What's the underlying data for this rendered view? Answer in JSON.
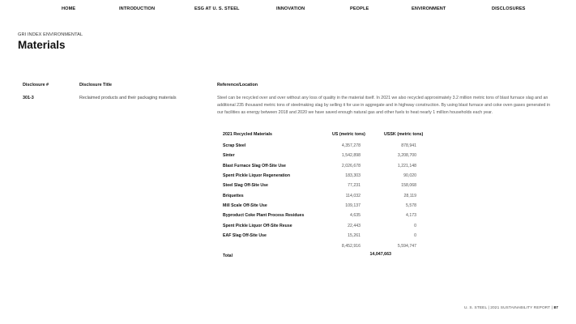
{
  "nav": {
    "items": [
      "HOME",
      "INTRODUCTION",
      "ESG AT U. S. STEEL",
      "INNOVATION",
      "PEOPLE",
      "ENVIRONMENT",
      "DISCLOSURES"
    ]
  },
  "header": {
    "section_label": "GRI INDEX ENVIRONMENTAL",
    "title": "Materials"
  },
  "disclosure_table": {
    "columns": [
      "Disclosure #",
      "Disclosure Title",
      "Reference/Location"
    ],
    "row": {
      "code": "301-3",
      "title": "Reclaimed products and their packaging materials",
      "reference": "Steel can be recycled over and over without any loss of quality in the material itself. In 2021 we also recycled approximately 3.2 million metric tons of blast furnace slag and an additional 235 thousand metric tons of steelmaking slag by selling it for use in aggregate and in highway construction. By using blast furnace and coke oven gases generated in our facilities as energy between 2018 and 2020 we have saved enough natural gas and other fuels to heat nearly 1 million households each year."
    }
  },
  "recycled_table": {
    "headers": [
      "2021 Recycled Materials",
      "US (metric tons)",
      "USSK (metric tons)"
    ],
    "rows": [
      {
        "name": "Scrap Steel",
        "us": "4,357,278",
        "ussk": "878,941"
      },
      {
        "name": "Sinter",
        "us": "1,542,898",
        "ussk": "3,208,700"
      },
      {
        "name": "Blast Furnace Slag Off-Site Use",
        "us": "2,026,678",
        "ussk": "1,221,148"
      },
      {
        "name": "Spent Pickle Liquor Regeneration",
        "us": "183,303",
        "ussk": "90,020"
      },
      {
        "name": "Steel Slag Off-Site Use",
        "us": "77,231",
        "ussk": "158,068"
      },
      {
        "name": "Briquettes",
        "us": "114,032",
        "ussk": "28,119"
      },
      {
        "name": "Mill Scale Off-Site Use",
        "us": "109,137",
        "ussk": "5,578"
      },
      {
        "name": "Byproduct Coke Plant Process Residues",
        "us": "4,635",
        "ussk": "4,173"
      },
      {
        "name": "Spent Pickle Liquor Off-Site Reuse",
        "us": "22,443",
        "ussk": "0"
      },
      {
        "name": "EAF Slag Off-Site Use",
        "us": "15,261",
        "ussk": "0"
      },
      {
        "name": "",
        "us": "8,452,916",
        "ussk": "5,594,747"
      }
    ],
    "total_label": "Total",
    "total_value": "14,047,663"
  },
  "footer": {
    "text": "U. S. STEEL | 2021 SUSTAINABILITY REPORT |",
    "page": "87"
  }
}
